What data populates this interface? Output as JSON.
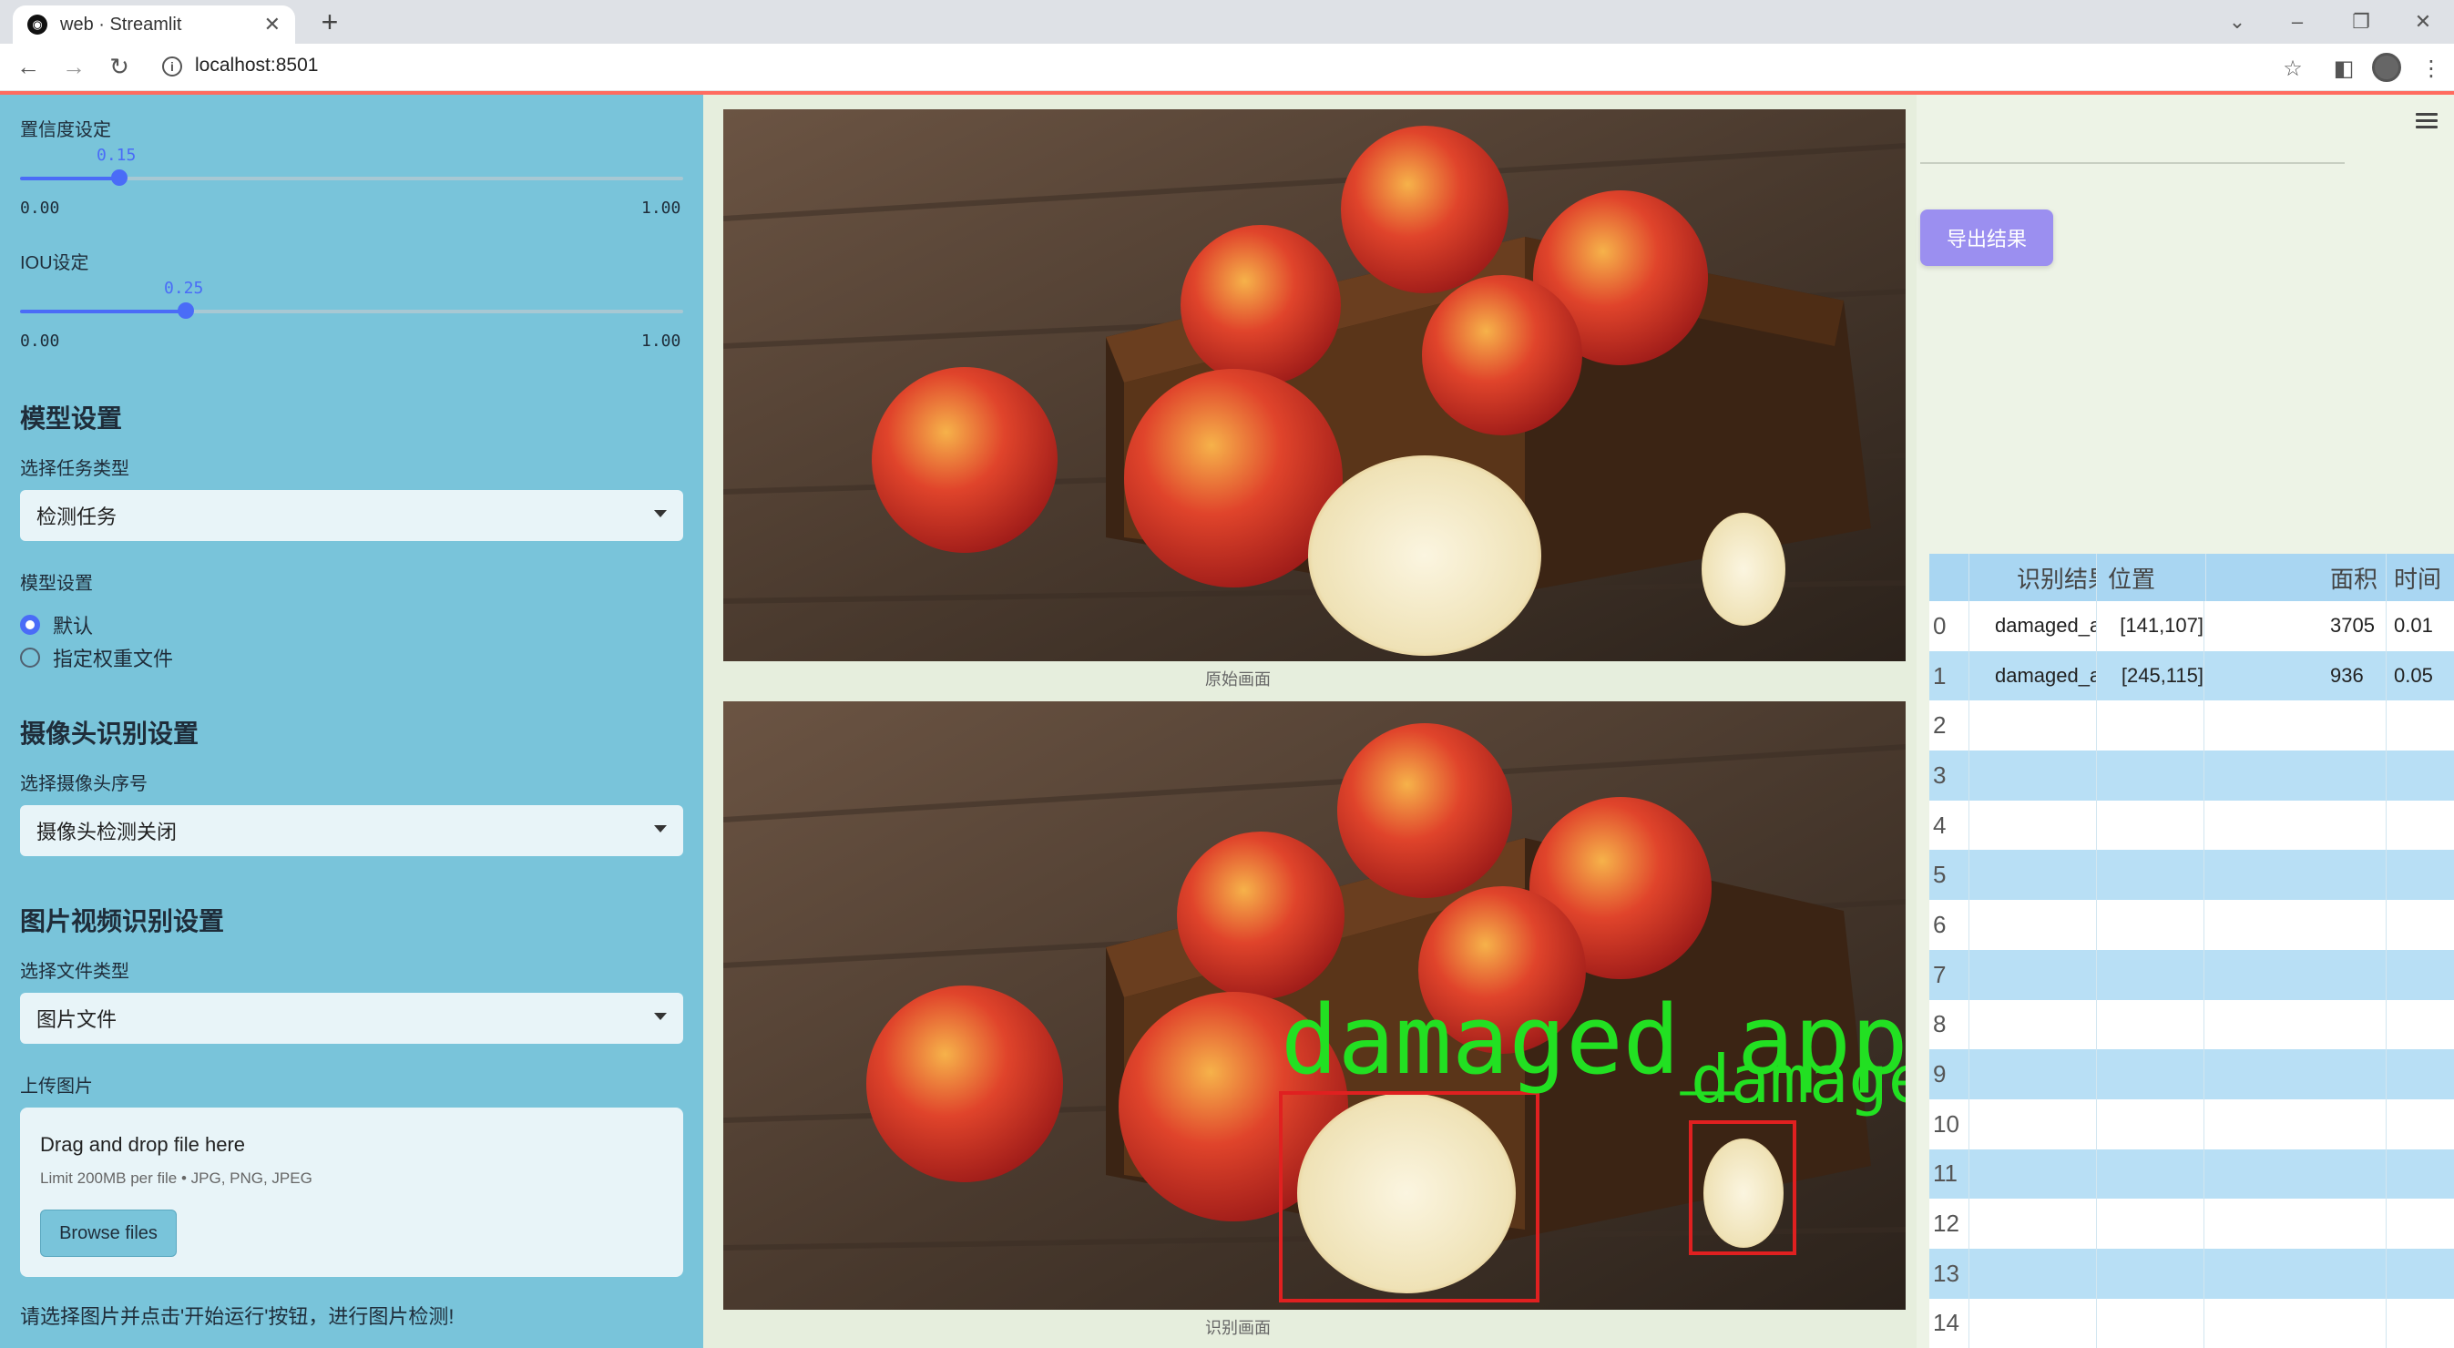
{
  "browser": {
    "tab_title": "web · Streamlit",
    "url": "localhost:8501"
  },
  "sidebar": {
    "conf_label": "置信度设定",
    "conf_value": "0.15",
    "conf_fraction": 0.15,
    "conf_min": "0.00",
    "conf_max": "1.00",
    "iou_label": "IOU设定",
    "iou_value": "0.25",
    "iou_fraction": 0.25,
    "iou_min": "0.00",
    "iou_max": "1.00",
    "model_heading": "模型设置",
    "task_label": "选择任务类型",
    "task_value": "检测任务",
    "model_label": "模型设置",
    "radio_default": "默认",
    "radio_custom": "指定权重文件",
    "camera_heading": "摄像头识别设置",
    "camera_label": "选择摄像头序号",
    "camera_value": "摄像头检测关闭",
    "media_heading": "图片视频识别设置",
    "filetype_label": "选择文件类型",
    "filetype_value": "图片文件",
    "upload_label": "上传图片",
    "upload_title": "Drag and drop file here",
    "upload_limit": "Limit 200MB per file • JPG, PNG, JPEG",
    "browse_label": "Browse files",
    "note": "请选择图片并点击'开始运行'按钮，进行图片检测!"
  },
  "main": {
    "original_caption": "原始画面",
    "result_caption": "识别画面",
    "detection_label": "damaged_apple",
    "export_label": "导出结果"
  },
  "table": {
    "headers": [
      "识别结果",
      "位置",
      "面积",
      "时间"
    ],
    "rows": [
      {
        "idx": "0",
        "result": "damaged_apple",
        "pos": "[141,107]",
        "area": "3705",
        "time": "0.01"
      },
      {
        "idx": "1",
        "result": "damaged_apple",
        "pos": "[245,115]",
        "area": "936",
        "time": "0.05"
      },
      {
        "idx": "2"
      },
      {
        "idx": "3"
      },
      {
        "idx": "4"
      },
      {
        "idx": "5"
      },
      {
        "idx": "6"
      },
      {
        "idx": "7"
      },
      {
        "idx": "8"
      },
      {
        "idx": "9"
      },
      {
        "idx": "10"
      },
      {
        "idx": "11"
      },
      {
        "idx": "12"
      },
      {
        "idx": "13"
      },
      {
        "idx": "14"
      }
    ]
  },
  "colors": {
    "sidebar_bg": "#79c4da",
    "accent": "#4a6cf7",
    "detection_box": "#e02020",
    "detection_text": "#22e022",
    "export_button": "#9b8ff0"
  }
}
